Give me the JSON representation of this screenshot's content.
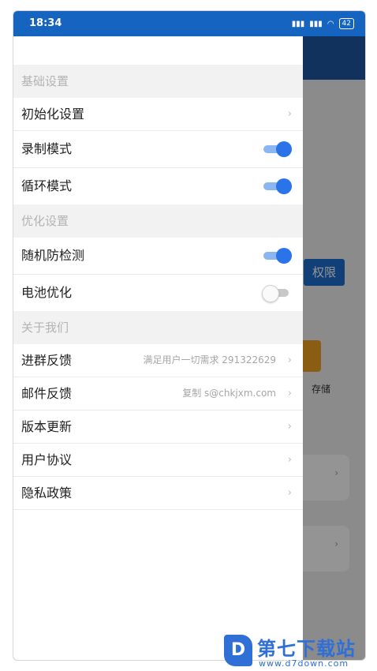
{
  "status_bar": {
    "time": "18:34",
    "signal_1": "ᴴᴰ.ıl",
    "signal_2": "ᴴᴰ.ıl",
    "wifi_icon": "wifi-icon",
    "battery": "42"
  },
  "background_app": {
    "permission_button": "权限",
    "storage_label": "存储"
  },
  "drawer": {
    "sections": [
      {
        "title": "基础设置",
        "rows": [
          {
            "label": "初始化设置",
            "type": "link"
          },
          {
            "label": "录制模式",
            "type": "toggle",
            "on": true
          },
          {
            "label": "循环模式",
            "type": "toggle",
            "on": true
          }
        ]
      },
      {
        "title": "优化设置",
        "rows": [
          {
            "label": "随机防检测",
            "type": "toggle",
            "on": true
          },
          {
            "label": "电池优化",
            "type": "toggle",
            "on": false
          }
        ]
      },
      {
        "title": "关于我们",
        "rows": [
          {
            "label": "进群反馈",
            "type": "link",
            "value": "满足用户一切需求 291322629"
          },
          {
            "label": "邮件反馈",
            "type": "link",
            "value": "复制 s@chkjxm.com"
          },
          {
            "label": "版本更新",
            "type": "link"
          },
          {
            "label": "用户协议",
            "type": "link"
          },
          {
            "label": "隐私政策",
            "type": "link"
          }
        ]
      }
    ]
  },
  "chevron": "›",
  "watermark": {
    "logo_letter": "D",
    "name": "第七下载站",
    "url": "www.d7down.com"
  },
  "colors": {
    "accent": "#2a73e8",
    "header": "#1565c0"
  }
}
